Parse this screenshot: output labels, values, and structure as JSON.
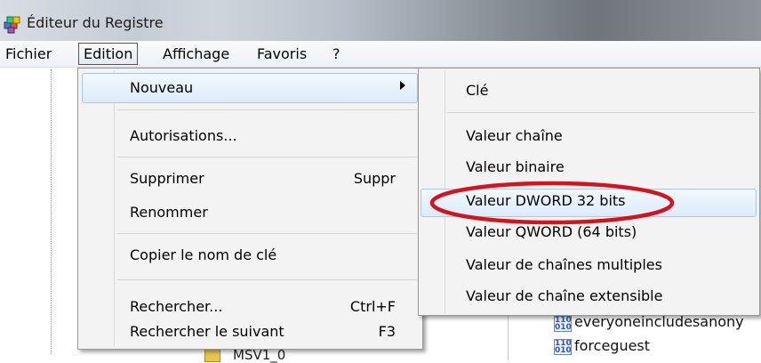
{
  "window": {
    "title": "Éditeur du Registre",
    "icon": "regedit-cubes-icon"
  },
  "menubar": {
    "items": [
      "Fichier",
      "Edition",
      "Affichage",
      "Favoris",
      "?"
    ]
  },
  "edit_menu": {
    "items": [
      {
        "label": "Nouveau",
        "shortcut": "",
        "submenu": true
      },
      {
        "label": "Autorisations...",
        "shortcut": ""
      },
      {
        "label": "Supprimer",
        "shortcut": "Suppr"
      },
      {
        "label": "Renommer",
        "shortcut": ""
      },
      {
        "label": "Copier le nom de clé",
        "shortcut": ""
      },
      {
        "label": "Rechercher...",
        "shortcut": "Ctrl+F"
      },
      {
        "label": "Rechercher le suivant",
        "shortcut": "F3"
      }
    ]
  },
  "new_submenu": {
    "items": [
      {
        "label": "Clé"
      },
      {
        "label": "Valeur chaîne"
      },
      {
        "label": "Valeur binaire"
      },
      {
        "label": "Valeur DWORD 32 bits"
      },
      {
        "label": "Valeur QWORD (64 bits)"
      },
      {
        "label": "Valeur de chaînes multiples"
      },
      {
        "label": "Valeur de chaîne extensible"
      }
    ],
    "highlighted": "Valeur DWORD 32 bits"
  },
  "background": {
    "tree_partial": "MSV1_0",
    "values": [
      {
        "name": "everyoneincludesanony",
        "icon": "reg-binary-value-icon"
      },
      {
        "name": "forceguest",
        "icon": "reg-binary-value-icon"
      }
    ]
  },
  "colors": {
    "highlight_ellipse": "#d4141a",
    "hover_border": "#a8c7e9",
    "hover_fill": "#dcebfb"
  }
}
